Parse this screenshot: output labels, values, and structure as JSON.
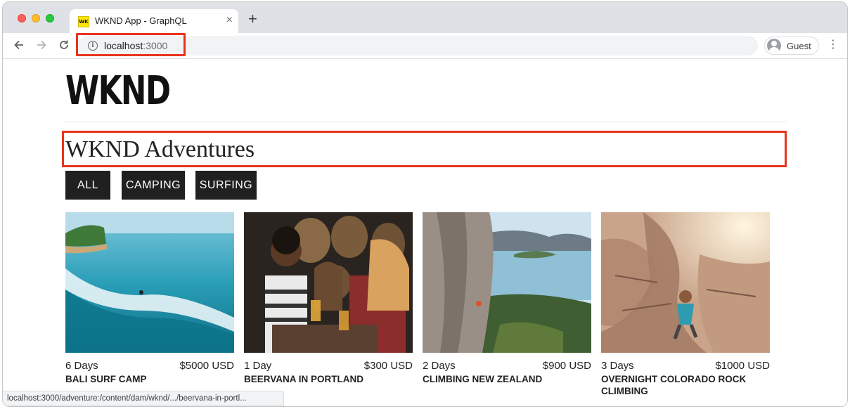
{
  "browser": {
    "tab_title": "WKND App - GraphQL",
    "favicon_text": "WK",
    "close_glyph": "×",
    "new_tab_glyph": "+",
    "url_host": "localhost",
    "url_port": ":3000",
    "profile_label": "Guest",
    "status_url": "localhost:3000/adventure:/content/dam/wknd/.../beervana-in-portl...",
    "icons": {
      "back": "arrow-left-icon",
      "forward": "arrow-right-icon",
      "reload": "reload-icon",
      "info": "info-icon",
      "menu": "more-vert-icon"
    }
  },
  "page": {
    "logo": "WKND",
    "title": "WKND Adventures",
    "filters": [
      "ALL",
      "CAMPING",
      "SURFING"
    ],
    "adventures": [
      {
        "duration": "6 Days",
        "price": "$5000 USD",
        "title": "BALI SURF CAMP"
      },
      {
        "duration": "1 Day",
        "price": "$300 USD",
        "title": "BEERVANA IN PORTLAND"
      },
      {
        "duration": "2 Days",
        "price": "$900 USD",
        "title": "CLIMBING NEW ZEALAND"
      },
      {
        "duration": "3 Days",
        "price": "$1000 USD",
        "title": "OVERNIGHT COLORADO ROCK CLIMBING"
      }
    ]
  },
  "colors": {
    "highlight": "#e8341c",
    "filter_bg": "#202020",
    "tabstrip_bg": "#dee1e6"
  }
}
